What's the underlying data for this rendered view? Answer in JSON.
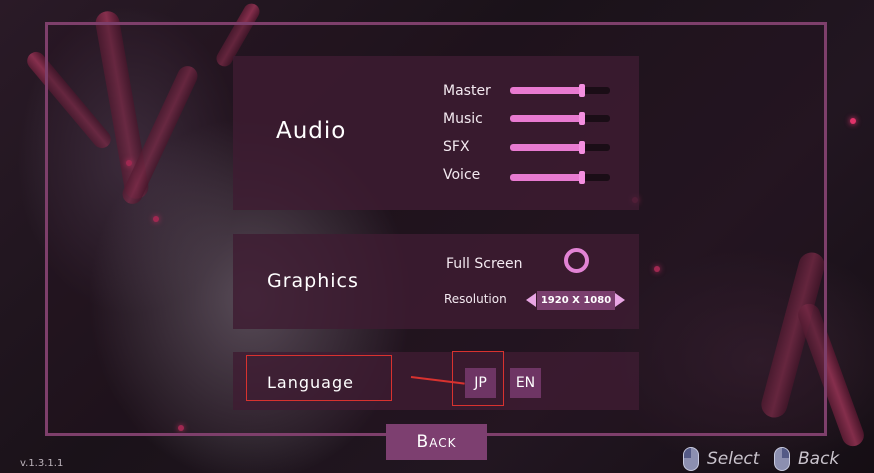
{
  "audio": {
    "title": "Audio",
    "sliders": [
      {
        "label": "Master",
        "value": 0.72
      },
      {
        "label": "Music",
        "value": 0.72
      },
      {
        "label": "SFX",
        "value": 0.72
      },
      {
        "label": "Voice",
        "value": 0.72
      }
    ]
  },
  "graphics": {
    "title": "Graphics",
    "fullscreen_label": "Full Screen",
    "resolution_label": "Resolution",
    "resolution_value": "1920 X 1080"
  },
  "language": {
    "title": "Language",
    "options": [
      "JP",
      "EN"
    ]
  },
  "back_button": "Back",
  "version": "v.1.3.1.1",
  "hints": {
    "select": "Select",
    "back": "Back"
  },
  "colors": {
    "accent": "#e87ad0",
    "panel": "#3e1c32",
    "frame": "#7e3f6b",
    "button": "#7d3f70",
    "annotation": "#d8322f"
  }
}
